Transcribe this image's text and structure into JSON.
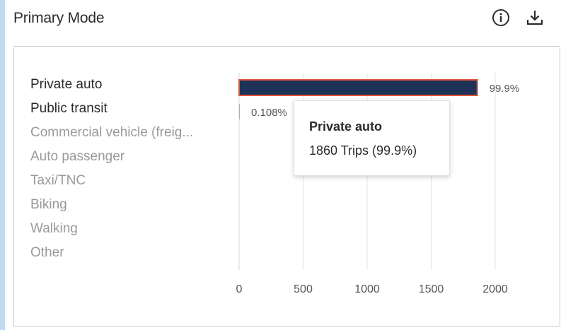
{
  "panel": {
    "title": "Primary Mode",
    "info_icon": "info-circle-icon",
    "download_icon": "download-icon"
  },
  "chart_data": {
    "type": "bar",
    "orientation": "horizontal",
    "categories": [
      "Private auto",
      "Public transit",
      "Commercial vehicle (freig...",
      "Auto passenger",
      "Taxi/TNC",
      "Biking",
      "Walking",
      "Other"
    ],
    "values": [
      1860,
      2,
      0,
      0,
      0,
      0,
      0,
      0
    ],
    "percent_labels": [
      "99.9%",
      "0.108%",
      "",
      "",
      "",
      "",
      "",
      ""
    ],
    "active_categories": [
      true,
      true,
      false,
      false,
      false,
      false,
      false,
      false
    ],
    "x_ticks": [
      0,
      500,
      1000,
      1500,
      2000
    ],
    "xlim": [
      0,
      2000
    ],
    "grid": true,
    "bar_color": "#1e3258",
    "highlight_color": "#e0533b"
  },
  "tooltip": {
    "title": "Private auto",
    "value": "1860 Trips (99.9%)"
  }
}
